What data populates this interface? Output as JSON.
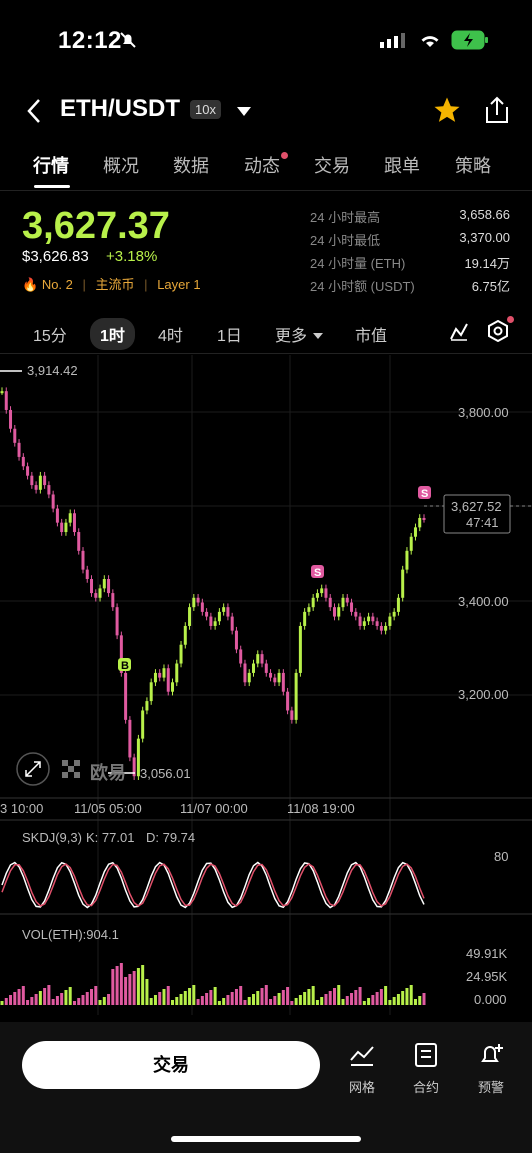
{
  "status": {
    "time": "12:12"
  },
  "header": {
    "pair": "ETH/USDT",
    "leverage": "10x"
  },
  "tabs": [
    "行情",
    "概况",
    "数据",
    "动态",
    "交易",
    "跟单",
    "策略"
  ],
  "ticker": {
    "price": "3,627.37",
    "price_usd": "$3,626.83",
    "change": "+3.18%",
    "rank": "No. 2",
    "tag_main": "主流币",
    "tag_layer": "Layer 1",
    "stats": [
      {
        "label": "24 小时最高",
        "value": "3,658.66"
      },
      {
        "label": "24 小时最低",
        "value": "3,370.00"
      },
      {
        "label": "24 小时量 (ETH)",
        "value": "19.14万"
      },
      {
        "label": "24 小时额 (USDT)",
        "value": "6.75亿"
      }
    ]
  },
  "timeframes": {
    "items": [
      "15分",
      "1时",
      "4时",
      "1日"
    ],
    "more": "更多",
    "market_cap": "市值"
  },
  "chart_labels": {
    "high_marker": "3,914.42",
    "low_marker": "3,056.01",
    "y_ticks": [
      "3,800.00",
      "3,400.00",
      "3,200.00"
    ],
    "current_price": "3,627.52",
    "countdown": "47:41",
    "x_ticks": [
      "3 10:00",
      "11/05 05:00",
      "11/07 00:00",
      "11/08 19:00"
    ],
    "watermark": "欧易",
    "skdj": "SKDJ(9,3)",
    "skdj_k": "K: 77.01",
    "skdj_d": "D: 79.74",
    "skdj_level": "80",
    "vol": "VOL(ETH):904.1",
    "vol_ticks": [
      "49.91K",
      "24.95K",
      "0.000"
    ]
  },
  "chart_data": {
    "type": "candlestick",
    "ylim": [
      3040,
      3960
    ],
    "series": [
      {
        "values": [
          3900,
          3860,
          3820,
          3790,
          3760,
          3740,
          3720,
          3700,
          3690,
          3720,
          3700,
          3680,
          3650,
          3620,
          3600,
          3620,
          3640,
          3600,
          3560,
          3520,
          3500,
          3470,
          3460,
          3480,
          3500,
          3470,
          3440,
          3380,
          3300,
          3200,
          3120,
          3080,
          3160,
          3220,
          3240,
          3280,
          3300,
          3290,
          3310,
          3260,
          3280,
          3320,
          3360,
          3400,
          3440,
          3460,
          3450,
          3430,
          3420,
          3400,
          3410,
          3430,
          3440,
          3420,
          3390,
          3350,
          3320,
          3280,
          3300,
          3320,
          3340,
          3320,
          3300,
          3290,
          3280,
          3300,
          3260,
          3220,
          3200,
          3300,
          3400,
          3430,
          3440,
          3460,
          3470,
          3480,
          3460,
          3440,
          3420,
          3440,
          3460,
          3450,
          3430,
          3420,
          3400,
          3410,
          3420,
          3410,
          3400,
          3390,
          3400,
          3420,
          3430,
          3460,
          3520,
          3560,
          3590,
          3610,
          3630,
          3628
        ]
      }
    ]
  },
  "bottom": {
    "trade": "交易",
    "grid": "网格",
    "contract": "合约",
    "alert": "预警"
  },
  "colors": {
    "up": "#b8f04a",
    "down": "#e05aa0",
    "accent": "#f5b400"
  }
}
